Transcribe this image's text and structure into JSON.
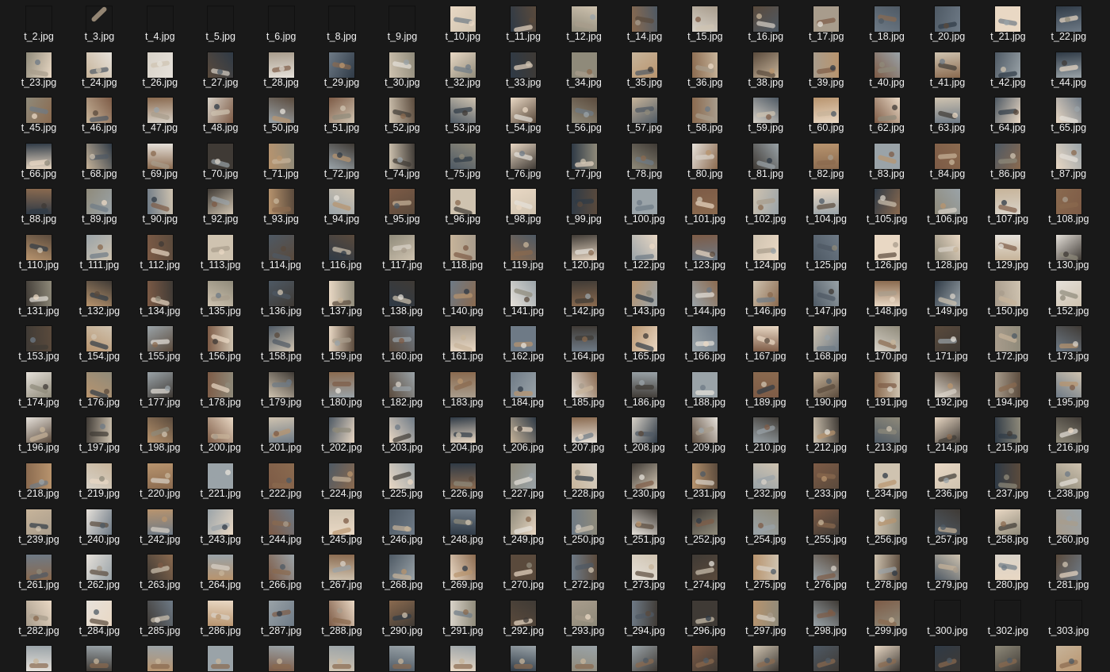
{
  "file_browser": {
    "view_mode": "large thumbnails",
    "files": [
      "t_2.jpg",
      "t_3.jpg",
      "t_4.jpg",
      "t_5.jpg",
      "t_6.jpg",
      "t_8.jpg",
      "t_9.jpg",
      "t_10.jpg",
      "t_11.jpg",
      "t_12.jpg",
      "t_14.jpg",
      "t_15.jpg",
      "t_16.jpg",
      "t_17.jpg",
      "t_18.jpg",
      "t_20.jpg",
      "t_21.jpg",
      "t_22.jpg",
      "t_23.jpg",
      "t_24.jpg",
      "t_26.jpg",
      "t_27.jpg",
      "t_28.jpg",
      "t_29.jpg",
      "t_30.jpg",
      "t_32.jpg",
      "t_33.jpg",
      "t_34.jpg",
      "t_35.jpg",
      "t_36.jpg",
      "t_38.jpg",
      "t_39.jpg",
      "t_40.jpg",
      "t_41.jpg",
      "t_42.jpg",
      "t_44.jpg",
      "t_45.jpg",
      "t_46.jpg",
      "t_47.jpg",
      "t_48.jpg",
      "t_50.jpg",
      "t_51.jpg",
      "t_52.jpg",
      "t_53.jpg",
      "t_54.jpg",
      "t_56.jpg",
      "t_57.jpg",
      "t_58.jpg",
      "t_59.jpg",
      "t_60.jpg",
      "t_62.jpg",
      "t_63.jpg",
      "t_64.jpg",
      "t_65.jpg",
      "t_66.jpg",
      "t_68.jpg",
      "t_69.jpg",
      "t_70.jpg",
      "t_71.jpg",
      "t_72.jpg",
      "t_74.jpg",
      "t_75.jpg",
      "t_76.jpg",
      "t_77.jpg",
      "t_78.jpg",
      "t_80.jpg",
      "t_81.jpg",
      "t_82.jpg",
      "t_83.jpg",
      "t_84.jpg",
      "t_86.jpg",
      "t_87.jpg",
      "t_88.jpg",
      "t_89.jpg",
      "t_90.jpg",
      "t_92.jpg",
      "t_93.jpg",
      "t_94.jpg",
      "t_95.jpg",
      "t_96.jpg",
      "t_98.jpg",
      "t_99.jpg",
      "t_100.jpg",
      "t_101.jpg",
      "t_102.jpg",
      "t_104.jpg",
      "t_105.jpg",
      "t_106.jpg",
      "t_107.jpg",
      "t_108.jpg",
      "t_110.jpg",
      "t_111.jpg",
      "t_112.jpg",
      "t_113.jpg",
      "t_114.jpg",
      "t_116.jpg",
      "t_117.jpg",
      "t_118.jpg",
      "t_119.jpg",
      "t_120.jpg",
      "t_122.jpg",
      "t_123.jpg",
      "t_124.jpg",
      "t_125.jpg",
      "t_126.jpg",
      "t_128.jpg",
      "t_129.jpg",
      "t_130.jpg",
      "t_131.jpg",
      "t_132.jpg",
      "t_134.jpg",
      "t_135.jpg",
      "t_136.jpg",
      "t_137.jpg",
      "t_138.jpg",
      "t_140.jpg",
      "t_141.jpg",
      "t_142.jpg",
      "t_143.jpg",
      "t_144.jpg",
      "t_146.jpg",
      "t_147.jpg",
      "t_148.jpg",
      "t_149.jpg",
      "t_150.jpg",
      "t_152.jpg",
      "t_153.jpg",
      "t_154.jpg",
      "t_155.jpg",
      "t_156.jpg",
      "t_158.jpg",
      "t_159.jpg",
      "t_160.jpg",
      "t_161.jpg",
      "t_162.jpg",
      "t_164.jpg",
      "t_165.jpg",
      "t_166.jpg",
      "t_167.jpg",
      "t_168.jpg",
      "t_170.jpg",
      "t_171.jpg",
      "t_172.jpg",
      "t_173.jpg",
      "t_174.jpg",
      "t_176.jpg",
      "t_177.jpg",
      "t_178.jpg",
      "t_179.jpg",
      "t_180.jpg",
      "t_182.jpg",
      "t_183.jpg",
      "t_184.jpg",
      "t_185.jpg",
      "t_186.jpg",
      "t_188.jpg",
      "t_189.jpg",
      "t_190.jpg",
      "t_191.jpg",
      "t_192.jpg",
      "t_194.jpg",
      "t_195.jpg",
      "t_196.jpg",
      "t_197.jpg",
      "t_198.jpg",
      "t_200.jpg",
      "t_201.jpg",
      "t_202.jpg",
      "t_203.jpg",
      "t_204.jpg",
      "t_206.jpg",
      "t_207.jpg",
      "t_208.jpg",
      "t_209.jpg",
      "t_210.jpg",
      "t_212.jpg",
      "t_213.jpg",
      "t_214.jpg",
      "t_215.jpg",
      "t_216.jpg",
      "t_218.jpg",
      "t_219.jpg",
      "t_220.jpg",
      "t_221.jpg",
      "t_222.jpg",
      "t_224.jpg",
      "t_225.jpg",
      "t_226.jpg",
      "t_227.jpg",
      "t_228.jpg",
      "t_230.jpg",
      "t_231.jpg",
      "t_232.jpg",
      "t_233.jpg",
      "t_234.jpg",
      "t_236.jpg",
      "t_237.jpg",
      "t_238.jpg",
      "t_239.jpg",
      "t_240.jpg",
      "t_242.jpg",
      "t_243.jpg",
      "t_244.jpg",
      "t_245.jpg",
      "t_246.jpg",
      "t_248.jpg",
      "t_249.jpg",
      "t_250.jpg",
      "t_251.jpg",
      "t_252.jpg",
      "t_254.jpg",
      "t_255.jpg",
      "t_256.jpg",
      "t_257.jpg",
      "t_258.jpg",
      "t_260.jpg",
      "t_261.jpg",
      "t_262.jpg",
      "t_263.jpg",
      "t_264.jpg",
      "t_266.jpg",
      "t_267.jpg",
      "t_268.jpg",
      "t_269.jpg",
      "t_270.jpg",
      "t_272.jpg",
      "t_273.jpg",
      "t_274.jpg",
      "t_275.jpg",
      "t_276.jpg",
      "t_278.jpg",
      "t_279.jpg",
      "t_280.jpg",
      "t_281.jpg",
      "t_282.jpg",
      "t_284.jpg",
      "t_285.jpg",
      "t_286.jpg",
      "t_287.jpg",
      "t_288.jpg",
      "t_290.jpg",
      "t_291.jpg",
      "t_292.jpg",
      "t_293.jpg",
      "t_294.jpg",
      "t_296.jpg",
      "t_297.jpg",
      "t_298.jpg",
      "t_299.jpg",
      "t_300.jpg",
      "t_302.jpg",
      "t_303.jpg"
    ],
    "partial_row_count": 18,
    "colors": {
      "background": "#191919",
      "caption_text": "#f0f0f0",
      "thumb_palette": [
        "#c7b49a",
        "#8a6a4f",
        "#d8d2c8",
        "#5a4a3c",
        "#a89c8c",
        "#6e7a86",
        "#e6e1da",
        "#3f3a35",
        "#b8946e",
        "#9aa3a8",
        "#7d5b46",
        "#cfc3b0",
        "#4e5964",
        "#e9d8c4",
        "#2f3a46",
        "#8f8a7a"
      ]
    }
  }
}
